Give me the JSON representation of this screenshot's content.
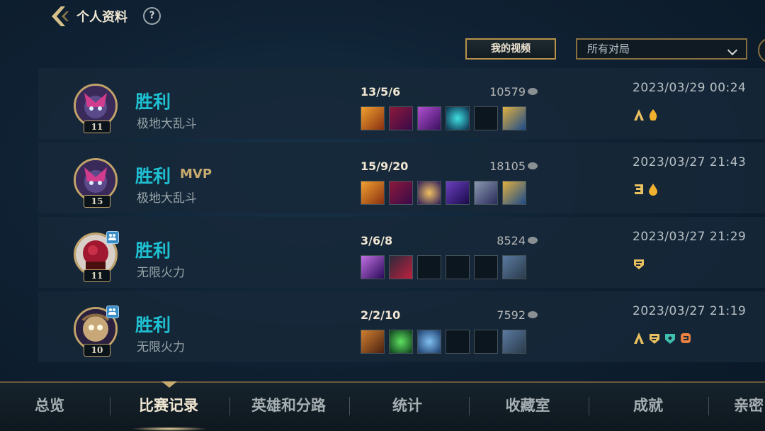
{
  "header": {
    "title": "个人资料",
    "help_symbol": "?"
  },
  "toolbar": {
    "video_button": "我的视频",
    "filter_value": "所有对局"
  },
  "matches": [
    {
      "result": "胜利",
      "mvp": "",
      "mode": "极地大乱斗",
      "level": "11",
      "kda": "13/5/6",
      "gold": "10579",
      "date": "2023/03/29 00:24",
      "party": false
    },
    {
      "result": "胜利",
      "mvp": "MVP",
      "mode": "极地大乱斗",
      "level": "15",
      "kda": "15/9/20",
      "gold": "18105",
      "date": "2023/03/27 21:43",
      "party": false
    },
    {
      "result": "胜利",
      "mvp": "",
      "mode": "无限火力",
      "level": "11",
      "kda": "3/6/8",
      "gold": "8524",
      "date": "2023/03/27 21:29",
      "party": true
    },
    {
      "result": "胜利",
      "mvp": "",
      "mode": "无限火力",
      "level": "10",
      "kda": "2/2/10",
      "gold": "7592",
      "date": "2023/03/27 21:19",
      "party": true
    }
  ],
  "nav": {
    "tabs": [
      "总览",
      "比赛记录",
      "英雄和分路",
      "统计",
      "收藏室",
      "成就",
      "亲密"
    ],
    "active_index": 1
  },
  "colors": {
    "accent_gold": "#c8aa6e",
    "victory_cyan": "#1ec0d2",
    "background": "#0f2133"
  }
}
